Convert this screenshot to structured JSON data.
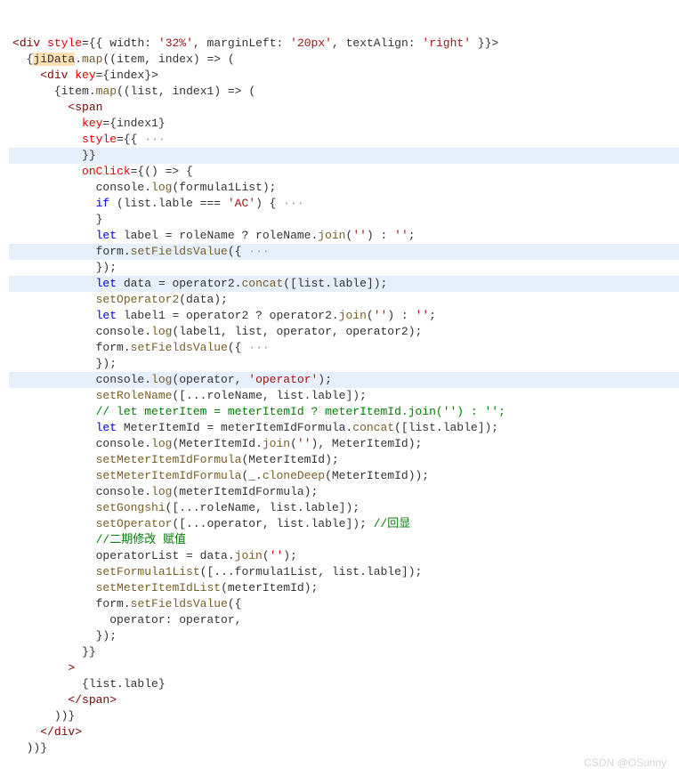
{
  "watermark": "CSDN @OSunny",
  "highlightLines": [
    8,
    14,
    16,
    22
  ],
  "lines": [
    {
      "indent": 0,
      "segs": [
        {
          "t": "<",
          "c": "angle"
        },
        {
          "t": "div",
          "c": "tag"
        },
        {
          "t": " ",
          "c": "punct"
        },
        {
          "t": "style",
          "c": "attr"
        },
        {
          "t": "={{ ",
          "c": "punct"
        },
        {
          "t": "width",
          "c": "punct"
        },
        {
          "t": ": ",
          "c": "punct"
        },
        {
          "t": "'32%'",
          "c": "str"
        },
        {
          "t": ", ",
          "c": "punct"
        },
        {
          "t": "marginLeft",
          "c": "punct"
        },
        {
          "t": ": ",
          "c": "punct"
        },
        {
          "t": "'20px'",
          "c": "str"
        },
        {
          "t": ", ",
          "c": "punct"
        },
        {
          "t": "textAlign",
          "c": "punct"
        },
        {
          "t": ": ",
          "c": "punct"
        },
        {
          "t": "'right'",
          "c": "str"
        },
        {
          "t": " }}>",
          "c": "punct"
        }
      ]
    },
    {
      "indent": 1,
      "segs": [
        {
          "t": "{",
          "c": "brace"
        },
        {
          "t": "jiData",
          "c": "punct",
          "sel": true
        },
        {
          "t": ".",
          "c": "punct"
        },
        {
          "t": "map",
          "c": "fn"
        },
        {
          "t": "((",
          "c": "punct"
        },
        {
          "t": "item",
          "c": "punct"
        },
        {
          "t": ", ",
          "c": "punct"
        },
        {
          "t": "index",
          "c": "punct"
        },
        {
          "t": ") => (",
          "c": "punct"
        }
      ]
    },
    {
      "indent": 2,
      "segs": [
        {
          "t": "<",
          "c": "angle"
        },
        {
          "t": "div",
          "c": "tag"
        },
        {
          "t": " ",
          "c": "punct"
        },
        {
          "t": "key",
          "c": "attr"
        },
        {
          "t": "={",
          "c": "punct"
        },
        {
          "t": "index",
          "c": "punct"
        },
        {
          "t": "}>",
          "c": "punct"
        }
      ]
    },
    {
      "indent": 3,
      "segs": [
        {
          "t": "{",
          "c": "brace"
        },
        {
          "t": "item",
          "c": "punct"
        },
        {
          "t": ".",
          "c": "punct"
        },
        {
          "t": "map",
          "c": "fn"
        },
        {
          "t": "((",
          "c": "punct"
        },
        {
          "t": "list",
          "c": "punct"
        },
        {
          "t": ", ",
          "c": "punct"
        },
        {
          "t": "index1",
          "c": "punct"
        },
        {
          "t": ") => (",
          "c": "punct"
        }
      ]
    },
    {
      "indent": 4,
      "segs": [
        {
          "t": "<",
          "c": "angle"
        },
        {
          "t": "span",
          "c": "tag"
        }
      ]
    },
    {
      "indent": 5,
      "segs": [
        {
          "t": "key",
          "c": "attr"
        },
        {
          "t": "={",
          "c": "punct"
        },
        {
          "t": "index1",
          "c": "punct"
        },
        {
          "t": "}",
          "c": "punct"
        }
      ]
    },
    {
      "indent": 5,
      "segs": [
        {
          "t": "style",
          "c": "attr"
        },
        {
          "t": "={{",
          "c": "punct"
        },
        {
          "t": " ···",
          "c": "ellip"
        }
      ]
    },
    {
      "indent": 5,
      "segs": [
        {
          "t": "}}",
          "c": "punct"
        }
      ]
    },
    {
      "indent": 5,
      "segs": [
        {
          "t": "onClick",
          "c": "attr"
        },
        {
          "t": "={() => {",
          "c": "punct"
        }
      ]
    },
    {
      "indent": 6,
      "segs": [
        {
          "t": "console",
          "c": "punct"
        },
        {
          "t": ".",
          "c": "punct"
        },
        {
          "t": "log",
          "c": "fn"
        },
        {
          "t": "(formula1List);",
          "c": "punct"
        }
      ]
    },
    {
      "indent": 6,
      "segs": [
        {
          "t": "if",
          "c": "kw"
        },
        {
          "t": " (list.lable === ",
          "c": "punct"
        },
        {
          "t": "'AC'",
          "c": "str"
        },
        {
          "t": ") {",
          "c": "punct"
        },
        {
          "t": " ···",
          "c": "ellip"
        }
      ]
    },
    {
      "indent": 6,
      "segs": [
        {
          "t": "}",
          "c": "punct"
        }
      ]
    },
    {
      "indent": 6,
      "segs": [
        {
          "t": "let",
          "c": "kw"
        },
        {
          "t": " label = roleName ? roleName.",
          "c": "punct"
        },
        {
          "t": "join",
          "c": "fn"
        },
        {
          "t": "(",
          "c": "punct"
        },
        {
          "t": "''",
          "c": "str"
        },
        {
          "t": ") : ",
          "c": "punct"
        },
        {
          "t": "''",
          "c": "str"
        },
        {
          "t": ";",
          "c": "punct"
        }
      ]
    },
    {
      "indent": 6,
      "segs": [
        {
          "t": "form.",
          "c": "punct"
        },
        {
          "t": "setFieldsValue",
          "c": "fn"
        },
        {
          "t": "({",
          "c": "punct"
        },
        {
          "t": " ···",
          "c": "ellip"
        }
      ]
    },
    {
      "indent": 6,
      "segs": [
        {
          "t": "});",
          "c": "punct"
        }
      ]
    },
    {
      "indent": 6,
      "segs": [
        {
          "t": "let",
          "c": "kw"
        },
        {
          "t": " data = operator2.",
          "c": "punct"
        },
        {
          "t": "concat",
          "c": "fn"
        },
        {
          "t": "([list.lable]);",
          "c": "punct"
        }
      ]
    },
    {
      "indent": 6,
      "segs": [
        {
          "t": "setOperator2",
          "c": "fn"
        },
        {
          "t": "(data);",
          "c": "punct"
        }
      ]
    },
    {
      "indent": 6,
      "segs": [
        {
          "t": "let",
          "c": "kw"
        },
        {
          "t": " label1 = operator2 ? operator2.",
          "c": "punct"
        },
        {
          "t": "join",
          "c": "fn"
        },
        {
          "t": "(",
          "c": "punct"
        },
        {
          "t": "''",
          "c": "str"
        },
        {
          "t": ") : ",
          "c": "punct"
        },
        {
          "t": "''",
          "c": "str"
        },
        {
          "t": ";",
          "c": "punct"
        }
      ]
    },
    {
      "indent": 6,
      "segs": [
        {
          "t": "console",
          "c": "punct"
        },
        {
          "t": ".",
          "c": "punct"
        },
        {
          "t": "log",
          "c": "fn"
        },
        {
          "t": "(label1, list, operator, operator2);",
          "c": "punct"
        }
      ]
    },
    {
      "indent": 6,
      "segs": [
        {
          "t": "form.",
          "c": "punct"
        },
        {
          "t": "setFieldsValue",
          "c": "fn"
        },
        {
          "t": "({",
          "c": "punct"
        },
        {
          "t": " ···",
          "c": "ellip"
        }
      ]
    },
    {
      "indent": 6,
      "segs": [
        {
          "t": "});",
          "c": "punct"
        }
      ]
    },
    {
      "indent": 6,
      "segs": [
        {
          "t": "console",
          "c": "punct"
        },
        {
          "t": ".",
          "c": "punct"
        },
        {
          "t": "log",
          "c": "fn"
        },
        {
          "t": "(operator, ",
          "c": "punct"
        },
        {
          "t": "'operator'",
          "c": "str"
        },
        {
          "t": ");",
          "c": "punct"
        }
      ]
    },
    {
      "indent": 6,
      "segs": [
        {
          "t": "setRoleName",
          "c": "fn"
        },
        {
          "t": "([...roleName, list.lable]);",
          "c": "punct"
        }
      ]
    },
    {
      "indent": 6,
      "segs": [
        {
          "t": "// let meterItem = meterItemId ? meterItemId.join('') : '';",
          "c": "comment"
        }
      ]
    },
    {
      "indent": 6,
      "segs": [
        {
          "t": "let",
          "c": "kw"
        },
        {
          "t": " MeterItemId = meterItemIdFormula.",
          "c": "punct"
        },
        {
          "t": "concat",
          "c": "fn"
        },
        {
          "t": "([list.lable]);",
          "c": "punct"
        }
      ]
    },
    {
      "indent": 6,
      "segs": [
        {
          "t": "console",
          "c": "punct"
        },
        {
          "t": ".",
          "c": "punct"
        },
        {
          "t": "log",
          "c": "fn"
        },
        {
          "t": "(MeterItemId.",
          "c": "punct"
        },
        {
          "t": "join",
          "c": "fn"
        },
        {
          "t": "(",
          "c": "punct"
        },
        {
          "t": "''",
          "c": "str"
        },
        {
          "t": "), MeterItemId);",
          "c": "punct"
        }
      ]
    },
    {
      "indent": 6,
      "segs": [
        {
          "t": "setMeterItemIdFormula",
          "c": "fn"
        },
        {
          "t": "(MeterItemId);",
          "c": "punct"
        }
      ]
    },
    {
      "indent": 6,
      "segs": [
        {
          "t": "setMeterItemIdFormula",
          "c": "fn"
        },
        {
          "t": "(_.",
          "c": "punct"
        },
        {
          "t": "cloneDeep",
          "c": "fn"
        },
        {
          "t": "(MeterItemId));",
          "c": "punct"
        }
      ]
    },
    {
      "indent": 6,
      "segs": [
        {
          "t": "console",
          "c": "punct"
        },
        {
          "t": ".",
          "c": "punct"
        },
        {
          "t": "log",
          "c": "fn"
        },
        {
          "t": "(meterItemIdFormula);",
          "c": "punct"
        }
      ]
    },
    {
      "indent": 6,
      "segs": [
        {
          "t": "setGongshi",
          "c": "fn"
        },
        {
          "t": "([...roleName, list.lable]);",
          "c": "punct"
        }
      ]
    },
    {
      "indent": 6,
      "segs": [
        {
          "t": "setOperator",
          "c": "fn"
        },
        {
          "t": "([...operator, list.lable]); ",
          "c": "punct"
        },
        {
          "t": "//回显",
          "c": "comment"
        }
      ]
    },
    {
      "indent": 6,
      "segs": [
        {
          "t": "//二期修改 赋值",
          "c": "comment"
        }
      ]
    },
    {
      "indent": 6,
      "segs": [
        {
          "t": "operatorList = data.",
          "c": "punct"
        },
        {
          "t": "join",
          "c": "fn"
        },
        {
          "t": "(",
          "c": "punct"
        },
        {
          "t": "''",
          "c": "str"
        },
        {
          "t": ");",
          "c": "punct"
        }
      ]
    },
    {
      "indent": 6,
      "segs": [
        {
          "t": "setFormula1List",
          "c": "fn"
        },
        {
          "t": "([...formula1List, list.lable]);",
          "c": "punct"
        }
      ]
    },
    {
      "indent": 6,
      "segs": [
        {
          "t": "setMeterItemIdList",
          "c": "fn"
        },
        {
          "t": "(meterItemId);",
          "c": "punct"
        }
      ]
    },
    {
      "indent": 6,
      "segs": [
        {
          "t": "form.",
          "c": "punct"
        },
        {
          "t": "setFieldsValue",
          "c": "fn"
        },
        {
          "t": "({",
          "c": "punct"
        }
      ]
    },
    {
      "indent": 7,
      "segs": [
        {
          "t": "operator: operator,",
          "c": "punct"
        }
      ]
    },
    {
      "indent": 6,
      "segs": [
        {
          "t": "});",
          "c": "punct"
        }
      ]
    },
    {
      "indent": 5,
      "segs": [
        {
          "t": "}}",
          "c": "punct"
        }
      ]
    },
    {
      "indent": 4,
      "segs": [
        {
          "t": ">",
          "c": "angle"
        }
      ]
    },
    {
      "indent": 5,
      "segs": [
        {
          "t": "{list.lable}",
          "c": "punct"
        }
      ]
    },
    {
      "indent": 4,
      "segs": [
        {
          "t": "</",
          "c": "angle"
        },
        {
          "t": "span",
          "c": "tag"
        },
        {
          "t": ">",
          "c": "angle"
        }
      ]
    },
    {
      "indent": 3,
      "segs": [
        {
          "t": "))}",
          "c": "punct"
        }
      ]
    },
    {
      "indent": 2,
      "segs": [
        {
          "t": "</",
          "c": "angle"
        },
        {
          "t": "div",
          "c": "tag"
        },
        {
          "t": ">",
          "c": "angle"
        }
      ]
    },
    {
      "indent": 1,
      "segs": [
        {
          "t": "))}",
          "c": "punct"
        }
      ]
    }
  ]
}
